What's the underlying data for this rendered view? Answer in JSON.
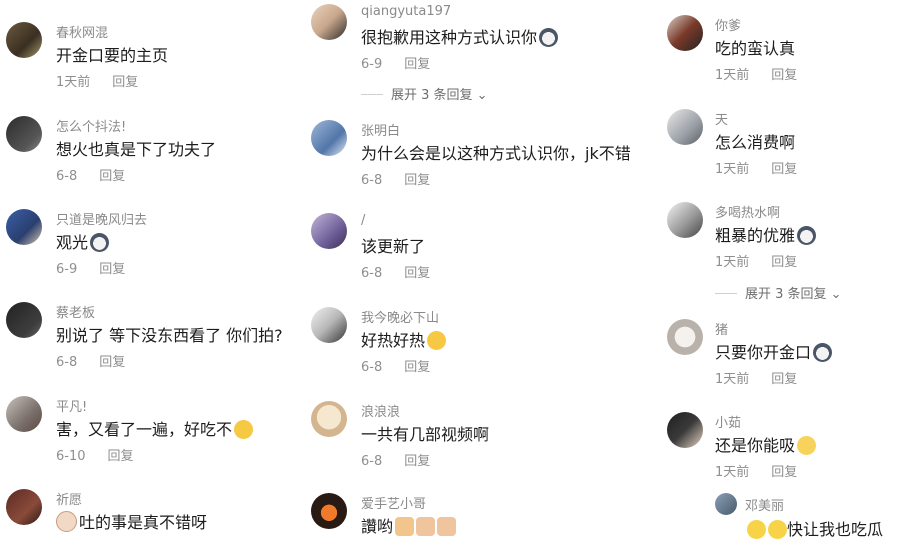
{
  "columns": [
    {
      "comments": [
        {
          "username": "春秋网混",
          "text": "开金口要的主页",
          "emoji": "",
          "date": "1天前",
          "reply": "回复"
        },
        {
          "username": "怎么个抖法!",
          "text": "想火也真是下了功夫了",
          "emoji": "",
          "date": "6-8",
          "reply": "回复"
        },
        {
          "username": "只道是晚风归去",
          "text": "观光",
          "emoji": "cat-emoji",
          "date": "6-9",
          "reply": "回复"
        },
        {
          "username": "蔡老板",
          "text": "别说了 等下没东西看了 你们拍?",
          "emoji": "",
          "date": "6-8",
          "reply": "回复"
        },
        {
          "username": "平凡!",
          "text": "害，又看了一遍，好吃不",
          "emoji": "laugh-cry-emoji",
          "date": "6-10",
          "reply": "回复"
        },
        {
          "username": "祈愿",
          "text": "吐的事是真不错呀",
          "emoji": "cat-face-emoji",
          "date": "",
          "reply": ""
        }
      ]
    },
    {
      "comments": [
        {
          "username": "qiangyuta197",
          "text": "很抱歉用这种方式认识你",
          "emoji": "cat-emoji",
          "date": "6-9",
          "reply": "回复"
        },
        {
          "username": "张明白",
          "text": "为什么会是以这种方式认识你，jk不错",
          "emoji": "",
          "date": "6-8",
          "reply": "回复"
        },
        {
          "username": "/",
          "text": "该更新了",
          "emoji": "",
          "date": "6-8",
          "reply": "回复"
        },
        {
          "username": "我今晚必下山",
          "text": "好热好热",
          "emoji": "heart-eyes-emoji",
          "date": "6-8",
          "reply": "回复"
        },
        {
          "username": "浪浪浪",
          "text": "一共有几部视频啊",
          "emoji": "",
          "date": "6-8",
          "reply": "回复"
        },
        {
          "username": "爱手艺小哥",
          "text": "讚哟",
          "emoji": "thumbs-hands-emoji",
          "date": "",
          "reply": ""
        }
      ],
      "expand_label": "展开 3 条回复"
    },
    {
      "comments": [
        {
          "username": "你爹",
          "text": "吃的蛮认真",
          "emoji": "",
          "date": "1天前",
          "reply": "回复"
        },
        {
          "username": "天",
          "text": "怎么消费啊",
          "emoji": "",
          "date": "1天前",
          "reply": "回复"
        },
        {
          "username": "多喝热水啊",
          "text": "粗暴的优雅",
          "emoji": "cat-emoji",
          "date": "1天前",
          "reply": "回复"
        },
        {
          "username": "猪",
          "text": "只要你开金口",
          "emoji": "cat-emoji",
          "date": "1天前",
          "reply": "回复"
        },
        {
          "username": "小茹",
          "text": "还是你能吸",
          "emoji": "thinking-emoji",
          "date": "1天前",
          "reply": "回复"
        },
        {
          "username": "邓美丽",
          "text": "快让我也吃瓜",
          "emoji": "tears-emoji",
          "date": "",
          "reply": ""
        }
      ],
      "expand_label": "展开 3 条回复"
    }
  ]
}
